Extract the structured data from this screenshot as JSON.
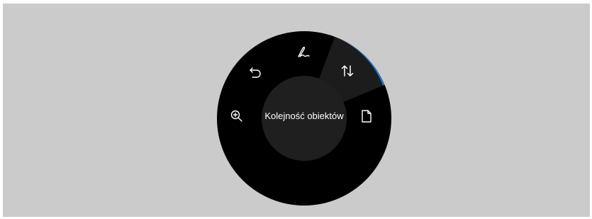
{
  "radial_menu": {
    "center_label": "Kolejność obiektów",
    "selected_item": "arrange-icon",
    "accent_color": "#1c78d0",
    "items": [
      {
        "name": "pen-icon"
      },
      {
        "name": "arrange-icon"
      },
      {
        "name": "page-icon"
      },
      {
        "name": "zoom-icon"
      },
      {
        "name": "undo-icon"
      }
    ]
  }
}
